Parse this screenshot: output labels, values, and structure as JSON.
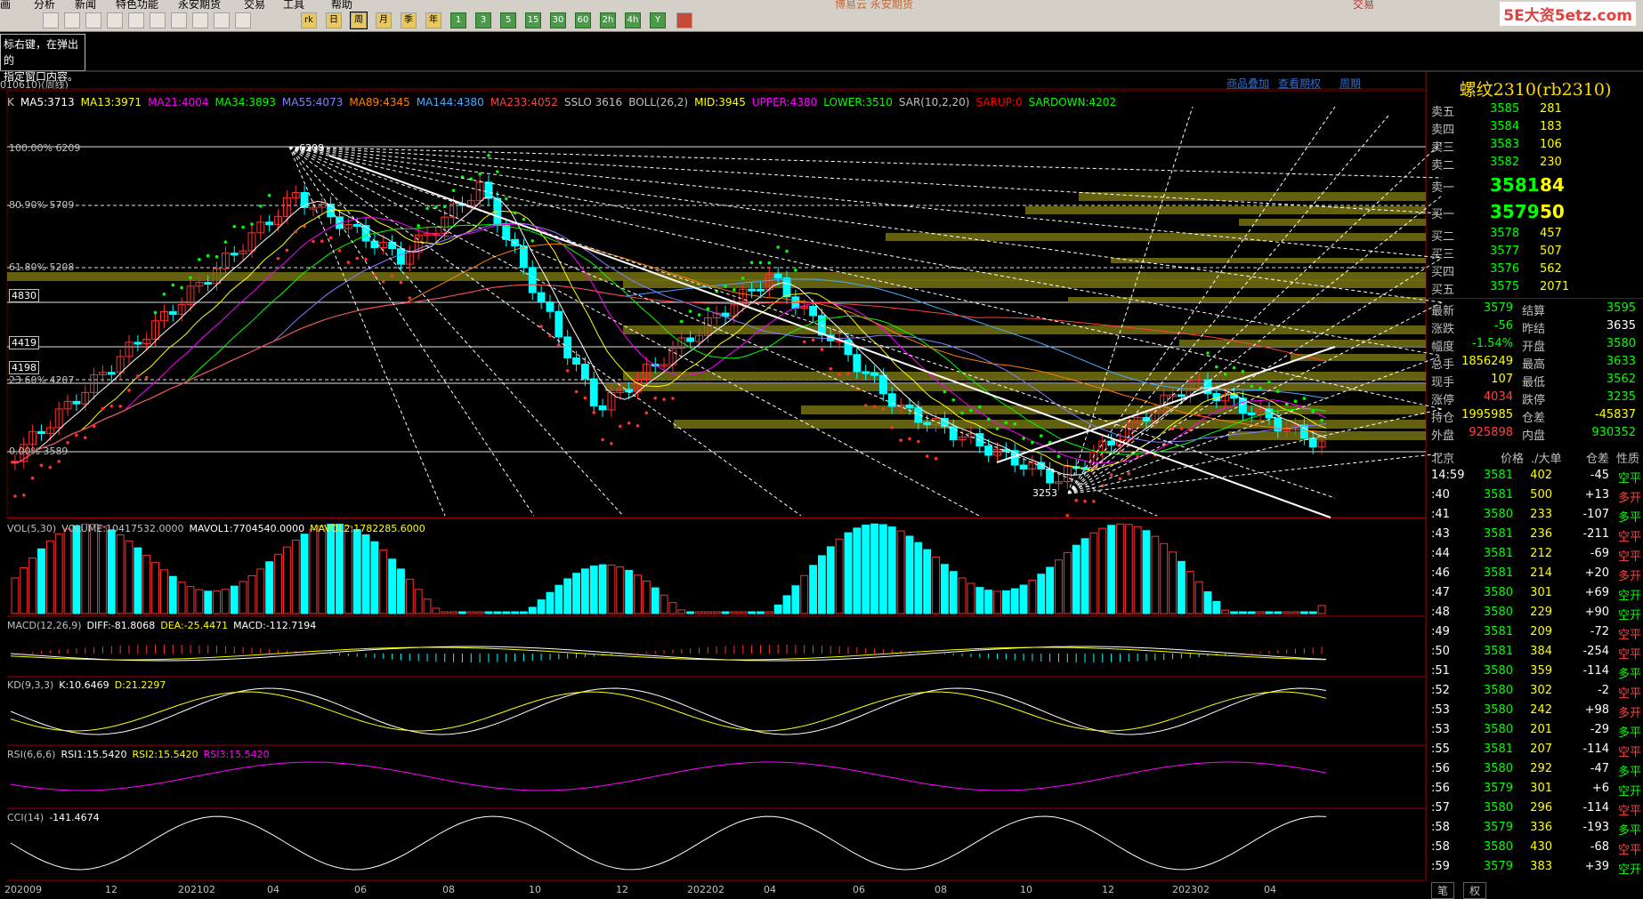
{
  "menu": {
    "items": [
      {
        "label": "画"
      },
      {
        "label": "分析"
      },
      {
        "label": "新闻"
      },
      {
        "label": "特色功能"
      },
      {
        "label": "永安期货"
      },
      {
        "label": "交易"
      },
      {
        "label": "工具"
      },
      {
        "label": "帮助"
      }
    ],
    "watermark": "博易云 永安期货",
    "trade_button": "交易"
  },
  "toolbar": {
    "buttons": [
      "rk",
      "日",
      "周",
      "月",
      "季",
      "年",
      "1",
      "3",
      "5",
      "15",
      "30",
      "60",
      "2h",
      "4h",
      "Y"
    ],
    "selected": "周"
  },
  "logo": "5E大资5etz.com",
  "hint": {
    "line1": "标右键，在弹出的",
    "line2": "指定窗口内容。"
  },
  "status": "010610)(周线)",
  "top_links": {
    "overlay": "商品叠加",
    "history": "查看期权",
    "period": "周期"
  },
  "chart_title": "螺纹2310(rb2310)",
  "ma_legend": [
    {
      "text": "K",
      "color": "#c0c0c0"
    },
    {
      "text": "MA5:3713",
      "color": "#ffffff"
    },
    {
      "text": "MA13:3971",
      "color": "#ffff00"
    },
    {
      "text": "MA21:4004",
      "color": "#ff00ff"
    },
    {
      "text": "MA34:3893",
      "color": "#00ff00"
    },
    {
      "text": "MA55:4073",
      "color": "#8080ff"
    },
    {
      "text": "MA89:4345",
      "color": "#ff8000"
    },
    {
      "text": "MA144:4380",
      "color": "#4aa8ff"
    },
    {
      "text": "MA233:4052",
      "color": "#ff4040"
    },
    {
      "text": "SSLO 3616",
      "color": "#c0c0c0"
    },
    {
      "text": "BOLL(26,2)",
      "color": "#c0c0c0"
    },
    {
      "text": "MID:3945",
      "color": "#ffff00"
    },
    {
      "text": "UPPER:4380",
      "color": "#ff00ff"
    },
    {
      "text": "LOWER:3510",
      "color": "#00ff00"
    },
    {
      "text": "SAR(10,2,20)",
      "color": "#c0c0c0"
    },
    {
      "text": "SARUP:0",
      "color": "#ff0000"
    },
    {
      "text": "SARDOWN:4202",
      "color": "#00ff00"
    }
  ],
  "fib_levels": [
    {
      "label": "100.00% 6209"
    },
    {
      "label": "80.90% 5709"
    },
    {
      "label": "61.80% 5208"
    },
    {
      "label": "4830"
    },
    {
      "label": "4419"
    },
    {
      "label": "4198"
    },
    {
      "label": "23.60% 4207"
    },
    {
      "label": "0.00% 3589"
    }
  ],
  "price_marks": {
    "high": "6208",
    "low": "3253"
  },
  "indicators": {
    "vol": [
      {
        "text": "VOL(5,30)",
        "color": "#c0c0c0"
      },
      {
        "text": "VOLUME:10417532.0000",
        "color": "#c0c0c0"
      },
      {
        "text": "MAVOL1:7704540.0000",
        "color": "#ffffff"
      },
      {
        "text": "MAVOL2:1782285.6000",
        "color": "#ffff00"
      }
    ],
    "macd": [
      {
        "text": "MACD(12,26,9)",
        "color": "#c0c0c0"
      },
      {
        "text": "DIFF:-81.8068",
        "color": "#ffffff"
      },
      {
        "text": "DEA:-25.4471",
        "color": "#ffff00"
      },
      {
        "text": "MACD:-112.7194",
        "color": "#ffffff"
      }
    ],
    "kd": [
      {
        "text": "KD(9,3,3)",
        "color": "#c0c0c0"
      },
      {
        "text": "K:10.6469",
        "color": "#ffffff"
      },
      {
        "text": "D:21.2297",
        "color": "#ffff00"
      }
    ],
    "rsi": [
      {
        "text": "RSI(6,6,6)",
        "color": "#c0c0c0"
      },
      {
        "text": "RSI1:15.5420",
        "color": "#ffffff"
      },
      {
        "text": "RSI2:15.5420",
        "color": "#ffff00"
      },
      {
        "text": "RSI3:15.5420",
        "color": "#ff00ff"
      }
    ],
    "cci": [
      {
        "text": "CCI(14)",
        "color": "#c0c0c0"
      },
      {
        "text": "-141.4674",
        "color": "#ffffff"
      }
    ]
  },
  "x_axis": [
    "202009",
    "12",
    "202102",
    "04",
    "06",
    "08",
    "10",
    "12",
    "202202",
    "04",
    "06",
    "08",
    "10",
    "12",
    "202302",
    "04"
  ],
  "orderbook": [
    {
      "label": "卖五",
      "price": "3585",
      "vol": "281"
    },
    {
      "label": "卖四",
      "price": "3584",
      "vol": "183"
    },
    {
      "label": "卖三",
      "price": "3583",
      "vol": "106"
    },
    {
      "label": "卖二",
      "price": "3582",
      "vol": "230"
    },
    {
      "label": "卖一",
      "price": "3581",
      "vol": "84"
    },
    {
      "label": "买一",
      "price": "3579",
      "vol": "50"
    },
    {
      "label": "买二",
      "price": "3578",
      "vol": "457"
    },
    {
      "label": "买三",
      "price": "3577",
      "vol": "507"
    },
    {
      "label": "买四",
      "price": "3576",
      "vol": "562"
    },
    {
      "label": "买五",
      "price": "3575",
      "vol": "2071"
    }
  ],
  "stats": [
    {
      "l1": "最新",
      "v1": "3579",
      "c1": "#00ff00",
      "l2": "结算",
      "v2": "3595",
      "c2": "#00ff00"
    },
    {
      "l1": "涨跌",
      "v1": "-56",
      "c1": "#00ff00",
      "l2": "昨结",
      "v2": "3635",
      "c2": "#ffffff"
    },
    {
      "l1": "幅度",
      "v1": "-1.54%",
      "c1": "#00ff00",
      "l2": "开盘",
      "v2": "3580",
      "c2": "#00ff00"
    },
    {
      "l1": "总手",
      "v1": "1856249",
      "c1": "#ffff00",
      "l2": "最高",
      "v2": "3633",
      "c2": "#00ff00"
    },
    {
      "l1": "现手",
      "v1": "107",
      "c1": "#ffff00",
      "l2": "最低",
      "v2": "3562",
      "c2": "#00ff00"
    },
    {
      "l1": "涨停",
      "v1": "4034",
      "c1": "#ff4040",
      "l2": "跌停",
      "v2": "3235",
      "c2": "#00ff00"
    },
    {
      "l1": "持仓",
      "v1": "1995985",
      "c1": "#ffff00",
      "l2": "仓差",
      "v2": "-45837",
      "c2": "#ffff00"
    },
    {
      "l1": "外盘",
      "v1": "925898",
      "c1": "#ff4040",
      "l2": "内盘",
      "v2": "930352",
      "c2": "#00ff00"
    }
  ],
  "trades_header": {
    "loc": "北京",
    "price": "价格",
    "vol": "./大单",
    "diff": "仓差",
    "type": "性质"
  },
  "trades": [
    {
      "time": "14:59",
      "price": "3581",
      "vol": "402",
      "diff": "-45",
      "type": "空平",
      "tc": "#00ff00"
    },
    {
      "time": ":40",
      "price": "3581",
      "vol": "500",
      "diff": "+13",
      "type": "多开",
      "tc": "#ff4040"
    },
    {
      "time": ":41",
      "price": "3580",
      "vol": "233",
      "diff": "-107",
      "type": "多平",
      "tc": "#00ff00"
    },
    {
      "time": ":43",
      "price": "3581",
      "vol": "236",
      "diff": "-211",
      "type": "空平",
      "tc": "#ff4040"
    },
    {
      "time": ":44",
      "price": "3581",
      "vol": "212",
      "diff": "-69",
      "type": "空平",
      "tc": "#ff4040"
    },
    {
      "time": ":46",
      "price": "3581",
      "vol": "214",
      "diff": "+20",
      "type": "多开",
      "tc": "#ff4040"
    },
    {
      "time": ":47",
      "price": "3580",
      "vol": "301",
      "diff": "+69",
      "type": "空开",
      "tc": "#00ff00"
    },
    {
      "time": ":48",
      "price": "3580",
      "vol": "229",
      "diff": "+90",
      "type": "空开",
      "tc": "#00ff00"
    },
    {
      "time": ":49",
      "price": "3581",
      "vol": "209",
      "diff": "-72",
      "type": "空平",
      "tc": "#ff4040"
    },
    {
      "time": ":50",
      "price": "3581",
      "vol": "384",
      "diff": "-254",
      "type": "空平",
      "tc": "#ff4040"
    },
    {
      "time": ":51",
      "price": "3580",
      "vol": "359",
      "diff": "-114",
      "type": "多平",
      "tc": "#00ff00"
    },
    {
      "time": ":52",
      "price": "3580",
      "vol": "302",
      "diff": "-2",
      "type": "空平",
      "tc": "#ff4040"
    },
    {
      "time": ":53",
      "price": "3580",
      "vol": "242",
      "diff": "+98",
      "type": "多开",
      "tc": "#ff4040"
    },
    {
      "time": ":53",
      "price": "3580",
      "vol": "201",
      "diff": "-29",
      "type": "多平",
      "tc": "#00ff00"
    },
    {
      "time": ":55",
      "price": "3581",
      "vol": "207",
      "diff": "-114",
      "type": "空平",
      "tc": "#ff4040"
    },
    {
      "time": ":56",
      "price": "3580",
      "vol": "292",
      "diff": "-47",
      "type": "多平",
      "tc": "#00ff00"
    },
    {
      "time": ":56",
      "price": "3579",
      "vol": "301",
      "diff": "+6",
      "type": "空开",
      "tc": "#00ff00"
    },
    {
      "time": ":57",
      "price": "3580",
      "vol": "296",
      "diff": "-114",
      "type": "空平",
      "tc": "#ff4040"
    },
    {
      "time": ":58",
      "price": "3579",
      "vol": "336",
      "diff": "-193",
      "type": "多平",
      "tc": "#00ff00"
    },
    {
      "time": ":58",
      "price": "3580",
      "vol": "430",
      "diff": "-68",
      "type": "空平",
      "tc": "#ff4040"
    },
    {
      "time": ":59",
      "price": "3579",
      "vol": "383",
      "diff": "+39",
      "type": "空开",
      "tc": "#00ff00"
    }
  ],
  "bottom_tabs": [
    "笔",
    "权"
  ]
}
